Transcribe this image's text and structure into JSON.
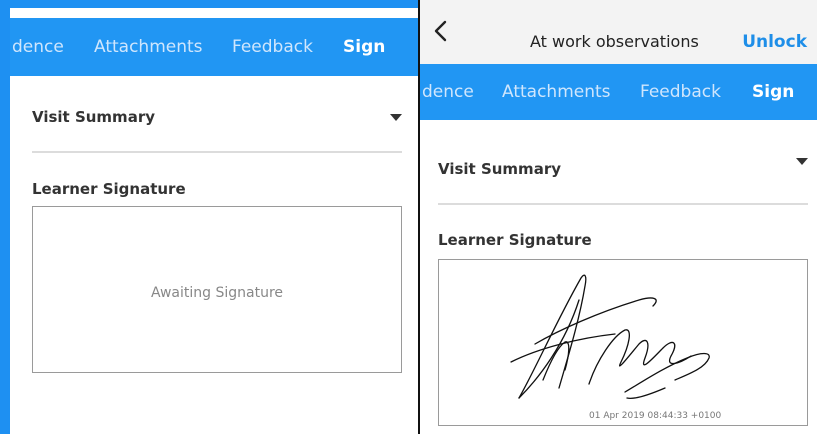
{
  "left": {
    "tabs": [
      {
        "label": "dence",
        "active": false
      },
      {
        "label": "Attachments",
        "active": false
      },
      {
        "label": "Feedback",
        "active": false
      },
      {
        "label": "Sign",
        "active": true
      }
    ],
    "visit_summary": "Visit Summary",
    "signature_heading": "Learner Signature",
    "signature_status": "Awaiting Signature"
  },
  "right": {
    "appbar": {
      "title": "At work observations",
      "action_label": "Unlock",
      "back_icon": "chevron-left-icon"
    },
    "tabs": [
      {
        "label": "dence",
        "active": false
      },
      {
        "label": "Attachments",
        "active": false
      },
      {
        "label": "Feedback",
        "active": false
      },
      {
        "label": "Sign",
        "active": true
      }
    ],
    "visit_summary": "Visit Summary",
    "signature_heading": "Learner Signature",
    "signature_timestamp": "01 Apr 2019 08:44:33 +0100"
  },
  "colors": {
    "tab_bar": "#2196f3",
    "accent": "#1e8ee8",
    "frame_blue": "#1e90f2"
  }
}
